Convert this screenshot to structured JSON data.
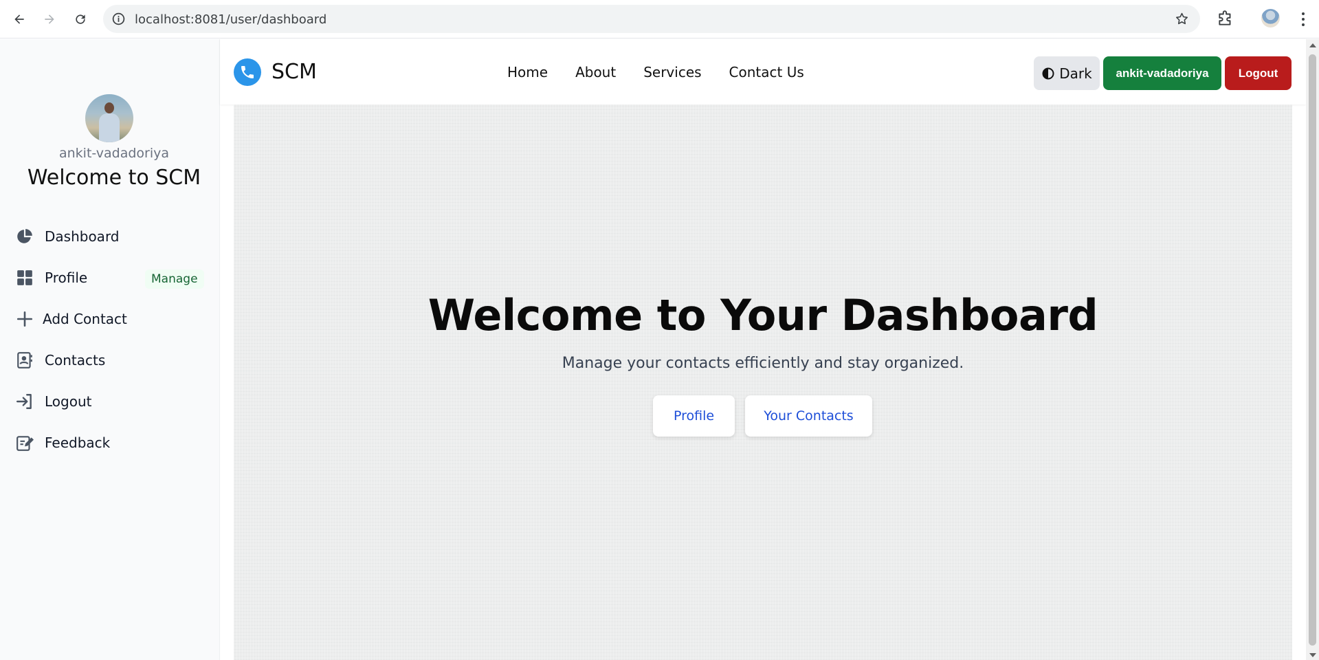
{
  "browser": {
    "url": "localhost:8081/user/dashboard"
  },
  "sidebar": {
    "username": "ankit-vadadoriya",
    "welcome": "Welcome to SCM",
    "items": [
      {
        "label": "Dashboard",
        "icon": "chart-pie-icon"
      },
      {
        "label": "Profile",
        "icon": "grid-icon",
        "badge": "Manage"
      },
      {
        "label": "Add Contact",
        "icon": "plus-icon"
      },
      {
        "label": "Contacts",
        "icon": "address-book-icon"
      },
      {
        "label": "Logout",
        "icon": "sign-in-icon"
      },
      {
        "label": "Feedback",
        "icon": "edit-note-icon"
      }
    ]
  },
  "navbar": {
    "brand": "SCM",
    "links": [
      "Home",
      "About",
      "Services",
      "Contact Us"
    ],
    "dark_label": "Dark",
    "user_button": "ankit-vadadoriya",
    "logout_button": "Logout"
  },
  "hero": {
    "title": "Welcome to Your Dashboard",
    "subtitle": "Manage your contacts efficiently and stay organized.",
    "profile_button": "Profile",
    "contacts_button": "Your Contacts"
  },
  "colors": {
    "brand_blue": "#2b95e9",
    "user_green": "#15803d",
    "logout_red": "#b91c1c",
    "link_blue": "#1d4ed8"
  }
}
